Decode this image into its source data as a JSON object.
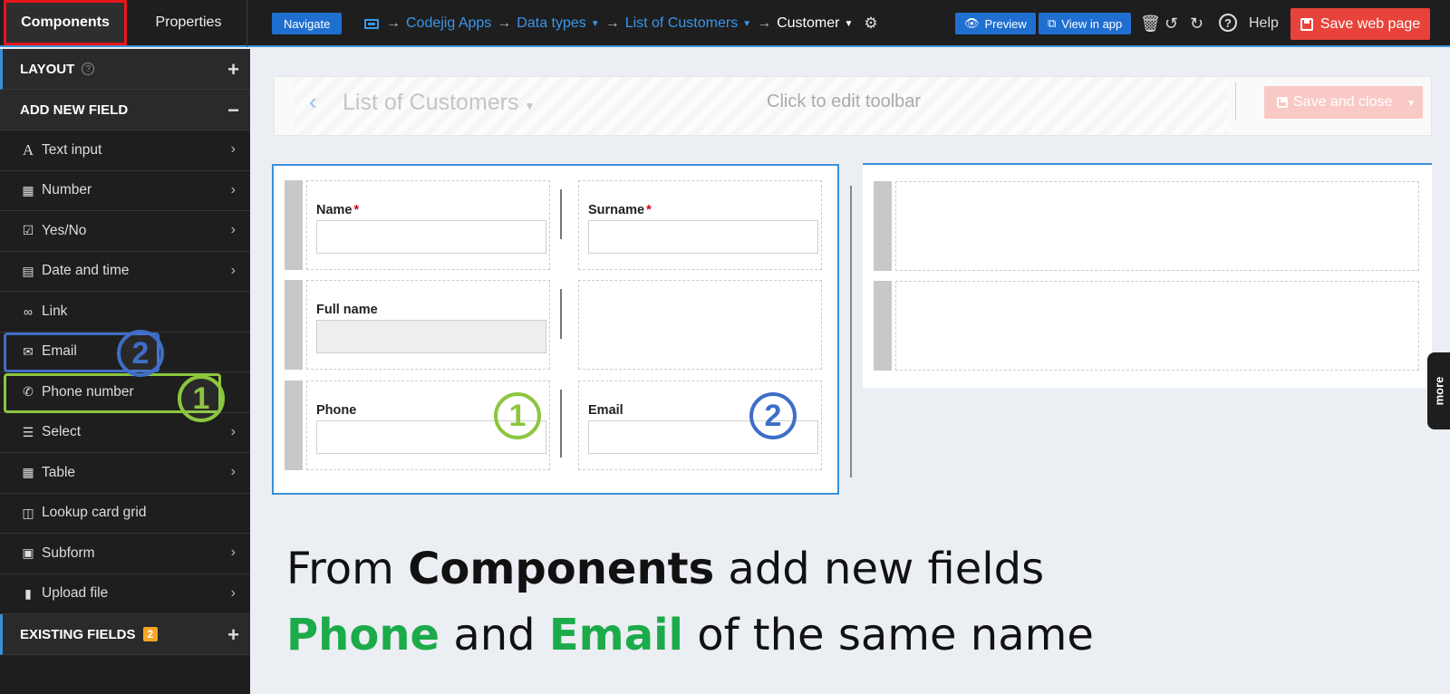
{
  "tabs": {
    "components": "Components",
    "properties": "Properties"
  },
  "header": {
    "navigate": "Navigate",
    "breadcrumbs": [
      "Codejig Apps",
      "Data types",
      "List of Customers",
      "Customer"
    ],
    "preview": "Preview",
    "view_in_app": "View in app",
    "help": "Help",
    "save_web_page": "Save web page"
  },
  "sidebar": {
    "layout_label": "LAYOUT",
    "add_new_field_label": "ADD NEW FIELD",
    "existing_fields_label": "EXISTING FIELDS",
    "existing_fields_count": "2",
    "items": [
      {
        "label": "Text input",
        "icon": "text-icon"
      },
      {
        "label": "Number",
        "icon": "calculator-icon"
      },
      {
        "label": "Yes/No",
        "icon": "checkbox-icon"
      },
      {
        "label": "Date and time",
        "icon": "calendar-icon"
      },
      {
        "label": "Link",
        "icon": "link-icon"
      },
      {
        "label": "Email",
        "icon": "envelope-icon"
      },
      {
        "label": "Phone number",
        "icon": "phone-icon"
      },
      {
        "label": "Select",
        "icon": "list-icon"
      },
      {
        "label": "Table",
        "icon": "table-icon"
      },
      {
        "label": "Lookup card grid",
        "icon": "card-icon"
      },
      {
        "label": "Subform",
        "icon": "subform-icon"
      },
      {
        "label": "Upload file",
        "icon": "file-icon"
      }
    ]
  },
  "markers": {
    "one": "1",
    "two": "2"
  },
  "toolbar": {
    "title": "List of Customers",
    "hint": "Click to edit toolbar",
    "save_close": "Save and close"
  },
  "form": {
    "name": "Name",
    "surname": "Surname",
    "full_name": "Full name",
    "phone": "Phone",
    "email": "Email",
    "required_mark": "*"
  },
  "more": "more",
  "caption": {
    "line1_pre": "From ",
    "line1_bold": "Components",
    "line1_post": " add new fields",
    "line2_phone": "Phone",
    "line2_and": " and ",
    "line2_email": "Email",
    "line2_post": " of the same name"
  },
  "colors": {
    "accent_blue": "#3a8fd8",
    "save_red": "#e8433a",
    "marker_green": "#8cc63f",
    "marker_blue": "#3f6ec8",
    "caption_green": "#1cab4a"
  }
}
